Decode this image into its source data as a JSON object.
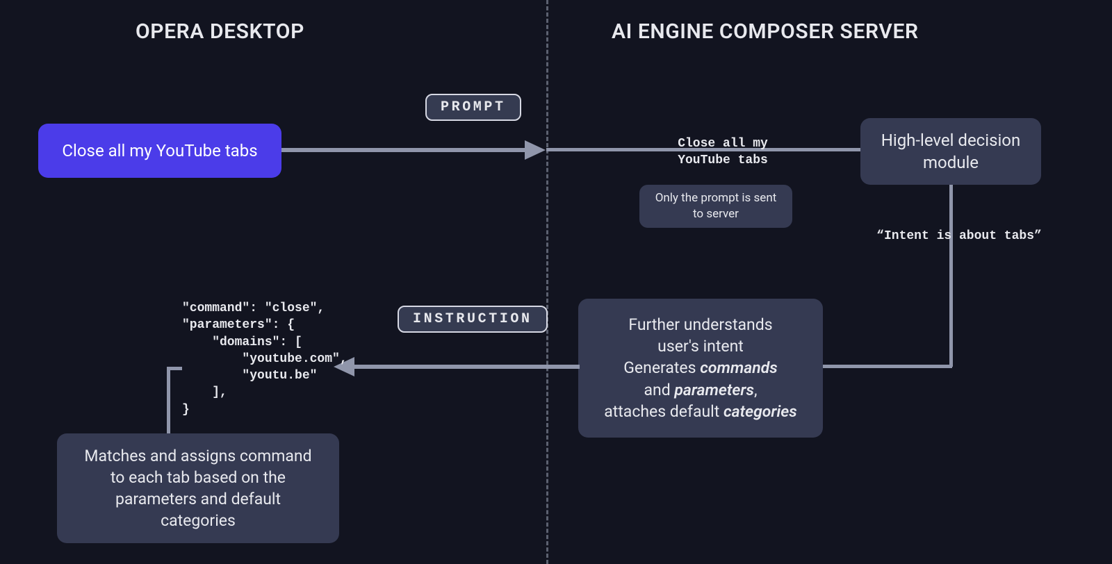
{
  "left": {
    "title": "OPERA DESKTOP",
    "prompt_box": "Close all my YouTube tabs",
    "code_lines": [
      "\"command\": \"close\",",
      "\"parameters\": {",
      "    \"domains\": [",
      "        \"youtube.com\",",
      "        \"youtu.be\"",
      "    ],",
      "}"
    ],
    "match_box": "Matches and assigns command to each tab based on the parameters and default categories"
  },
  "right": {
    "title": "AI ENGINE COMPOSER SERVER",
    "echo_prompt": "Close all my\nYouTube tabs",
    "note_box": "Only the prompt is sent to server",
    "decision_box": "High-level decision module",
    "intent_label": "“Intent is about tabs”",
    "understand_box_html": "Further understands<br>user's intent<br>Generates <em>commands</em><br>and <em>parameters</em>,<br>attaches default <em>categories</em>"
  },
  "labels": {
    "prompt_pill": "PROMPT",
    "instruction_pill": "INSTRUCTION"
  },
  "colors": {
    "accent": "#4b3ce9",
    "panel": "#353a52",
    "bg": "#121420",
    "line": "#9096ab",
    "text": "#e8e9ee"
  }
}
